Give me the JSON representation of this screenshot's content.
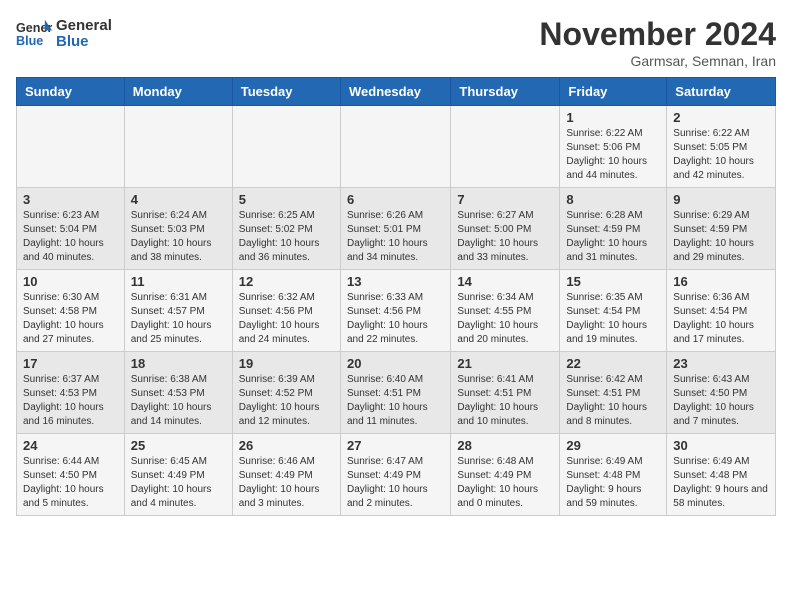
{
  "logo": {
    "general": "General",
    "blue": "Blue"
  },
  "header": {
    "month": "November 2024",
    "location": "Garmsar, Semnan, Iran"
  },
  "weekdays": [
    "Sunday",
    "Monday",
    "Tuesday",
    "Wednesday",
    "Thursday",
    "Friday",
    "Saturday"
  ],
  "weeks": [
    [
      {
        "day": "",
        "info": ""
      },
      {
        "day": "",
        "info": ""
      },
      {
        "day": "",
        "info": ""
      },
      {
        "day": "",
        "info": ""
      },
      {
        "day": "",
        "info": ""
      },
      {
        "day": "1",
        "info": "Sunrise: 6:22 AM\nSunset: 5:06 PM\nDaylight: 10 hours and 44 minutes."
      },
      {
        "day": "2",
        "info": "Sunrise: 6:22 AM\nSunset: 5:05 PM\nDaylight: 10 hours and 42 minutes."
      }
    ],
    [
      {
        "day": "3",
        "info": "Sunrise: 6:23 AM\nSunset: 5:04 PM\nDaylight: 10 hours and 40 minutes."
      },
      {
        "day": "4",
        "info": "Sunrise: 6:24 AM\nSunset: 5:03 PM\nDaylight: 10 hours and 38 minutes."
      },
      {
        "day": "5",
        "info": "Sunrise: 6:25 AM\nSunset: 5:02 PM\nDaylight: 10 hours and 36 minutes."
      },
      {
        "day": "6",
        "info": "Sunrise: 6:26 AM\nSunset: 5:01 PM\nDaylight: 10 hours and 34 minutes."
      },
      {
        "day": "7",
        "info": "Sunrise: 6:27 AM\nSunset: 5:00 PM\nDaylight: 10 hours and 33 minutes."
      },
      {
        "day": "8",
        "info": "Sunrise: 6:28 AM\nSunset: 4:59 PM\nDaylight: 10 hours and 31 minutes."
      },
      {
        "day": "9",
        "info": "Sunrise: 6:29 AM\nSunset: 4:59 PM\nDaylight: 10 hours and 29 minutes."
      }
    ],
    [
      {
        "day": "10",
        "info": "Sunrise: 6:30 AM\nSunset: 4:58 PM\nDaylight: 10 hours and 27 minutes."
      },
      {
        "day": "11",
        "info": "Sunrise: 6:31 AM\nSunset: 4:57 PM\nDaylight: 10 hours and 25 minutes."
      },
      {
        "day": "12",
        "info": "Sunrise: 6:32 AM\nSunset: 4:56 PM\nDaylight: 10 hours and 24 minutes."
      },
      {
        "day": "13",
        "info": "Sunrise: 6:33 AM\nSunset: 4:56 PM\nDaylight: 10 hours and 22 minutes."
      },
      {
        "day": "14",
        "info": "Sunrise: 6:34 AM\nSunset: 4:55 PM\nDaylight: 10 hours and 20 minutes."
      },
      {
        "day": "15",
        "info": "Sunrise: 6:35 AM\nSunset: 4:54 PM\nDaylight: 10 hours and 19 minutes."
      },
      {
        "day": "16",
        "info": "Sunrise: 6:36 AM\nSunset: 4:54 PM\nDaylight: 10 hours and 17 minutes."
      }
    ],
    [
      {
        "day": "17",
        "info": "Sunrise: 6:37 AM\nSunset: 4:53 PM\nDaylight: 10 hours and 16 minutes."
      },
      {
        "day": "18",
        "info": "Sunrise: 6:38 AM\nSunset: 4:53 PM\nDaylight: 10 hours and 14 minutes."
      },
      {
        "day": "19",
        "info": "Sunrise: 6:39 AM\nSunset: 4:52 PM\nDaylight: 10 hours and 12 minutes."
      },
      {
        "day": "20",
        "info": "Sunrise: 6:40 AM\nSunset: 4:51 PM\nDaylight: 10 hours and 11 minutes."
      },
      {
        "day": "21",
        "info": "Sunrise: 6:41 AM\nSunset: 4:51 PM\nDaylight: 10 hours and 10 minutes."
      },
      {
        "day": "22",
        "info": "Sunrise: 6:42 AM\nSunset: 4:51 PM\nDaylight: 10 hours and 8 minutes."
      },
      {
        "day": "23",
        "info": "Sunrise: 6:43 AM\nSunset: 4:50 PM\nDaylight: 10 hours and 7 minutes."
      }
    ],
    [
      {
        "day": "24",
        "info": "Sunrise: 6:44 AM\nSunset: 4:50 PM\nDaylight: 10 hours and 5 minutes."
      },
      {
        "day": "25",
        "info": "Sunrise: 6:45 AM\nSunset: 4:49 PM\nDaylight: 10 hours and 4 minutes."
      },
      {
        "day": "26",
        "info": "Sunrise: 6:46 AM\nSunset: 4:49 PM\nDaylight: 10 hours and 3 minutes."
      },
      {
        "day": "27",
        "info": "Sunrise: 6:47 AM\nSunset: 4:49 PM\nDaylight: 10 hours and 2 minutes."
      },
      {
        "day": "28",
        "info": "Sunrise: 6:48 AM\nSunset: 4:49 PM\nDaylight: 10 hours and 0 minutes."
      },
      {
        "day": "29",
        "info": "Sunrise: 6:49 AM\nSunset: 4:48 PM\nDaylight: 9 hours and 59 minutes."
      },
      {
        "day": "30",
        "info": "Sunrise: 6:49 AM\nSunset: 4:48 PM\nDaylight: 9 hours and 58 minutes."
      }
    ]
  ]
}
